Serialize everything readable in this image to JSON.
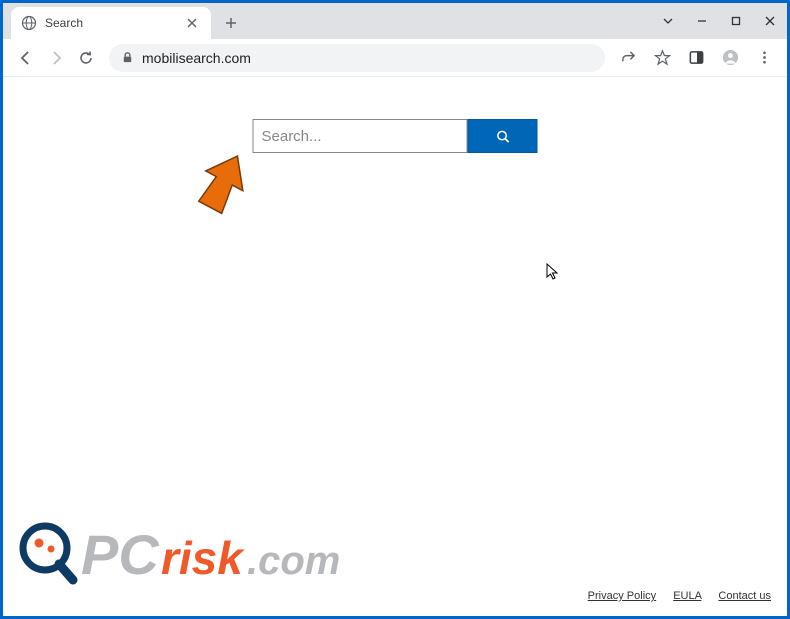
{
  "browser": {
    "tab_title": "Search",
    "url": "mobilisearch.com"
  },
  "page": {
    "search_placeholder": "Search..."
  },
  "footer": {
    "links": {
      "privacy": "Privacy Policy",
      "eula": "EULA",
      "contact": "Contact us"
    }
  },
  "watermark": {
    "text_pc": "PC",
    "text_risk": "risk",
    "text_com": ".com"
  }
}
